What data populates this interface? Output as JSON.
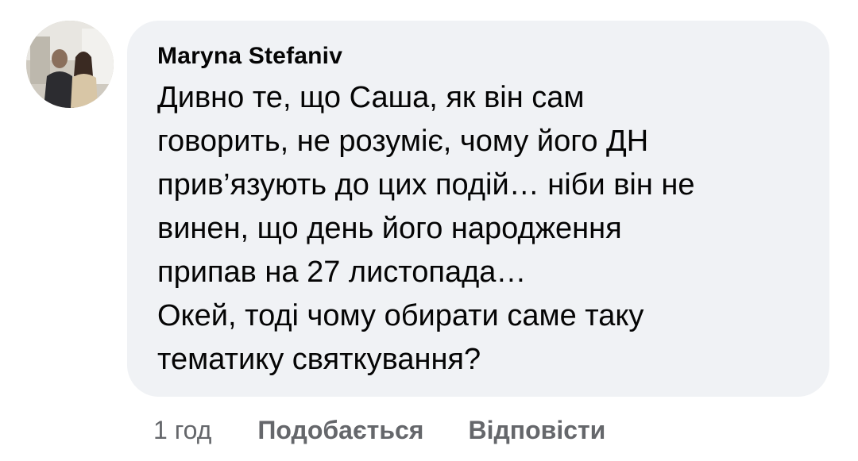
{
  "comment": {
    "author": "Maryna Stefaniv",
    "avatar_icon": "profile-photo",
    "text_lines": [
      "Дивно те, що Саша, як він сам",
      "говорить, не розуміє, чому його ДН",
      "прив’язують до цих подій… ніби він не",
      "винен, що день його народження",
      "припав на 27 листопада…",
      "Окей, тоді чому обирати саме таку",
      "тематику святкування?"
    ],
    "time": "1 год",
    "like_label": "Подобається",
    "reply_label": "Відповісти"
  },
  "colors": {
    "bubble_bg": "#f0f2f5",
    "text": "#050505",
    "secondary_text": "#65676b"
  }
}
